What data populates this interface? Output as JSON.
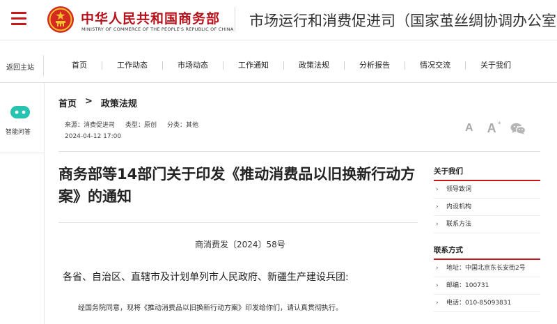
{
  "header": {
    "org_name_cn": "中华人民共和国商务部",
    "org_name_en": "MINISTRY OF COMMERCE OF THE PEOPLE'S REPUBLIC OF CHINA",
    "department_title": "市场运行和消费促进司（国家茧丝绸协调办公室）"
  },
  "nav": {
    "back_label": "返回主站",
    "items": [
      "首页",
      "工作动态",
      "市场动态",
      "工作通知",
      "政策法规",
      "分析报告",
      "情况交流",
      "关于我们"
    ]
  },
  "left_rail": {
    "assistant_label": "智能问答"
  },
  "breadcrumb": {
    "home": "首页",
    "separator": ">",
    "current": "政策法规"
  },
  "meta": {
    "source": "来源：消费促进司",
    "type": "类型：原创",
    "category": "分类：其他",
    "date": "2024-04-12 17:00"
  },
  "tools": {
    "font_small": "A",
    "font_large": "A",
    "font_large_sup": "+"
  },
  "article": {
    "title": "商务部等14部门关于印发《推动消费品以旧换新行动方案》的通知",
    "doc_number": "商消费发〔2024〕58号",
    "addressee": "各省、自治区、直辖市及计划单列市人民政府、新疆生产建设兵团:",
    "paragraph_1": "经国务院同意，现将《推动消费品以旧换新行动方案》印发给你们，请认真贯彻执行。"
  },
  "sidebar": {
    "about_title": "关于我们",
    "about_items": [
      "领导致词",
      "内设机构",
      "联系方法"
    ],
    "contact_title": "联系方式",
    "contact_items": [
      "地址：中国北京东长安街2号",
      "邮编：100731",
      "电话：010-85093831"
    ]
  },
  "colors": {
    "brand_red": "#c8161d",
    "emblem_gold": "#f2c230",
    "assistant_teal": "#27c2b0",
    "tool_gray": "#aaaaaa"
  },
  "icons": [
    "menu-icon",
    "national-emblem",
    "chat-bot-icon",
    "font-decrease-icon",
    "font-increase-icon",
    "wechat-icon",
    "chevron-right-icon"
  ]
}
